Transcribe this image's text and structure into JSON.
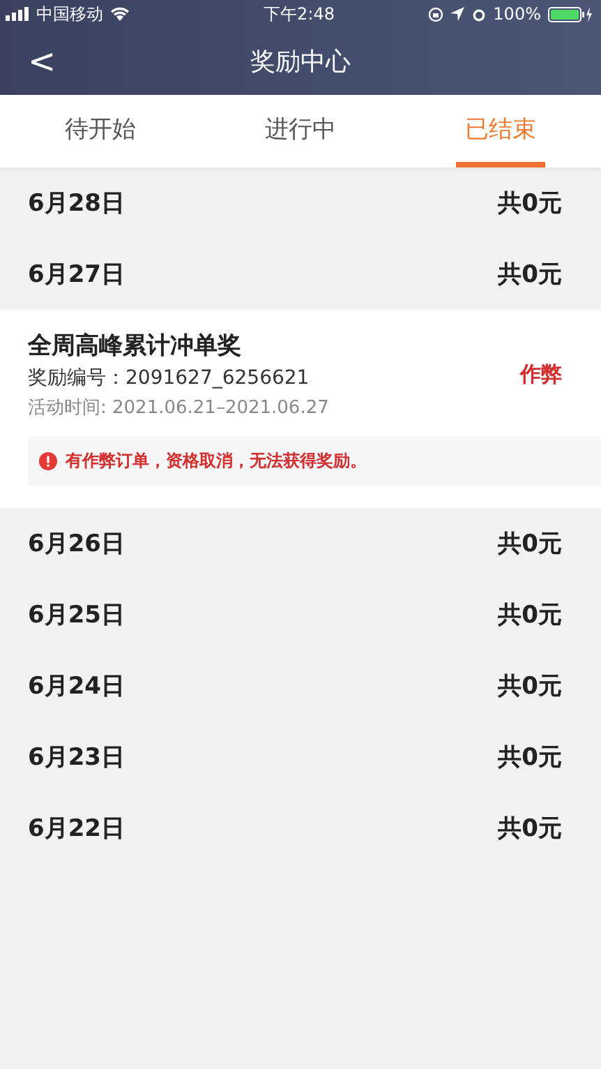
{
  "status_bar": {
    "carrier": "中国移动",
    "time": "下午2:48",
    "battery": "100%"
  },
  "nav": {
    "back": "<",
    "title": "奖励中心"
  },
  "tabs": [
    {
      "label": "待开始",
      "selected": false
    },
    {
      "label": "进行中",
      "selected": false
    },
    {
      "label": "已结束",
      "selected": true
    }
  ],
  "entries": [
    {
      "kind": "day",
      "date": "6月28日",
      "total": "共0元"
    },
    {
      "kind": "day",
      "date": "6月27日",
      "total": "共0元"
    },
    {
      "kind": "award",
      "title": "全周高峰累计冲单奖",
      "number": "奖励编号：2091627_6256621",
      "period": "活动时间: 2021.06.21–2021.06.27",
      "status": "作弊",
      "notice": "有作弊订单，资格取消，无法获得奖励。"
    },
    {
      "kind": "day",
      "date": "6月26日",
      "total": "共0元"
    },
    {
      "kind": "day",
      "date": "6月25日",
      "total": "共0元"
    },
    {
      "kind": "day",
      "date": "6月24日",
      "total": "共0元"
    },
    {
      "kind": "day",
      "date": "6月23日",
      "total": "共0元"
    },
    {
      "kind": "day",
      "date": "6月22日",
      "total": "共0元"
    }
  ]
}
